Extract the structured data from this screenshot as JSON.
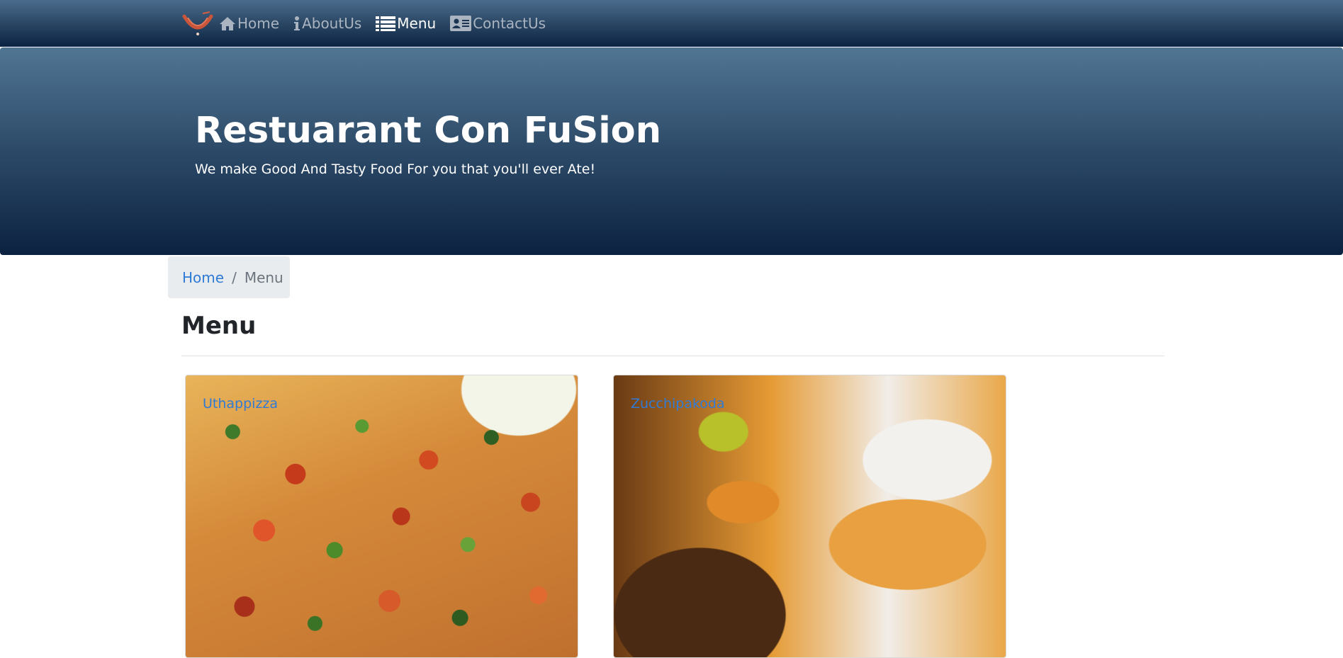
{
  "navbar": {
    "items": [
      {
        "label": "Home",
        "icon": "home-icon"
      },
      {
        "label": "AboutUs",
        "icon": "info-icon"
      },
      {
        "label": "Menu",
        "icon": "list-icon",
        "active": true
      },
      {
        "label": "ContactUs",
        "icon": "address-card-icon"
      }
    ]
  },
  "jumbotron": {
    "title": "Restuarant Con FuSion",
    "subtitle": "We make Good And Tasty Food For you that you'll ever Ate!"
  },
  "breadcrumb": {
    "home": "Home",
    "separator": "/",
    "current": "Menu"
  },
  "page": {
    "heading": "Menu"
  },
  "menu_items": [
    {
      "name": "Uthappizza"
    },
    {
      "name": "Zucchipakoda"
    }
  ],
  "colors": {
    "navbar_top": "#4c6c8e",
    "navbar_bottom": "#0b2342",
    "link": "#2f7bd6",
    "breadcrumb_bg": "#e9ecef"
  }
}
